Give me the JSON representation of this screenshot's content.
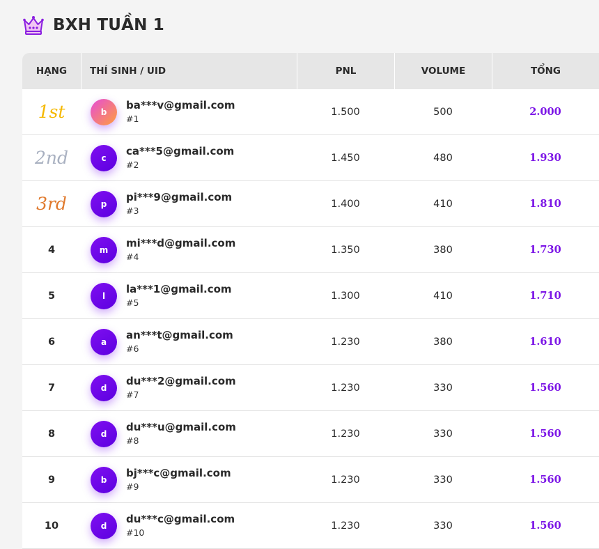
{
  "header": {
    "title": "BXH TUẦN 1",
    "icon": "crown-icon",
    "icon_color": "#8a1ee0"
  },
  "table": {
    "columns": {
      "rank": "HẠNG",
      "name": "THÍ SINH / UID",
      "pnl": "PNL",
      "volume": "VOLUME",
      "total": "TỔNG"
    },
    "rows": [
      {
        "rank": "1st",
        "medal": true,
        "medal_color": "#f5b800",
        "avatar_letter": "b",
        "avatar_style": "gradient",
        "email": "ba***v@gmail.com",
        "uid": "#1",
        "pnl": "1.500",
        "volume": "500",
        "total": "2.000"
      },
      {
        "rank": "2nd",
        "medal": true,
        "medal_color": "#a8b0c0",
        "avatar_letter": "c",
        "avatar_style": "purple",
        "email": "ca***5@gmail.com",
        "uid": "#2",
        "pnl": "1.450",
        "volume": "480",
        "total": "1.930"
      },
      {
        "rank": "3rd",
        "medal": true,
        "medal_color": "#e07a2e",
        "avatar_letter": "p",
        "avatar_style": "purple",
        "email": "pi***9@gmail.com",
        "uid": "#3",
        "pnl": "1.400",
        "volume": "410",
        "total": "1.810"
      },
      {
        "rank": "4",
        "medal": false,
        "avatar_letter": "m",
        "avatar_style": "purple",
        "email": "mi***d@gmail.com",
        "uid": "#4",
        "pnl": "1.350",
        "volume": "380",
        "total": "1.730"
      },
      {
        "rank": "5",
        "medal": false,
        "avatar_letter": "l",
        "avatar_style": "purple",
        "email": "la***1@gmail.com",
        "uid": "#5",
        "pnl": "1.300",
        "volume": "410",
        "total": "1.710"
      },
      {
        "rank": "6",
        "medal": false,
        "avatar_letter": "a",
        "avatar_style": "purple",
        "email": "an***t@gmail.com",
        "uid": "#6",
        "pnl": "1.230",
        "volume": "380",
        "total": "1.610"
      },
      {
        "rank": "7",
        "medal": false,
        "avatar_letter": "d",
        "avatar_style": "purple",
        "email": "du***2@gmail.com",
        "uid": "#7",
        "pnl": "1.230",
        "volume": "330",
        "total": "1.560"
      },
      {
        "rank": "8",
        "medal": false,
        "avatar_letter": "d",
        "avatar_style": "purple",
        "email": "du***u@gmail.com",
        "uid": "#8",
        "pnl": "1.230",
        "volume": "330",
        "total": "1.560"
      },
      {
        "rank": "9",
        "medal": false,
        "avatar_letter": "b",
        "avatar_style": "purple",
        "email": "bj***c@gmail.com",
        "uid": "#9",
        "pnl": "1.230",
        "volume": "330",
        "total": "1.560"
      },
      {
        "rank": "10",
        "medal": false,
        "avatar_letter": "d",
        "avatar_style": "purple",
        "email": "du***c@gmail.com",
        "uid": "#10",
        "pnl": "1.230",
        "volume": "330",
        "total": "1.560"
      }
    ]
  }
}
